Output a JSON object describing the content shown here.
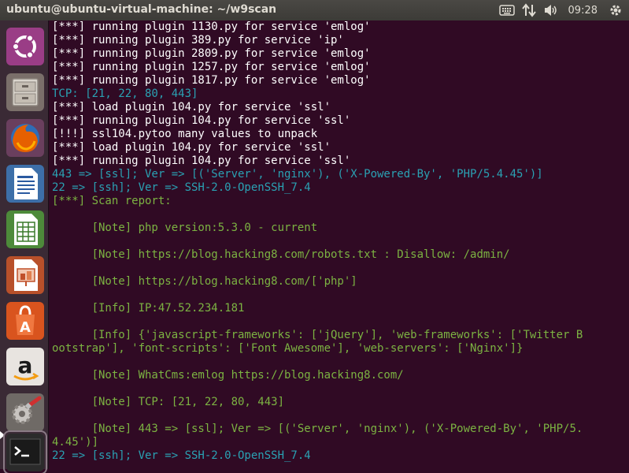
{
  "window": {
    "title": "ubuntu@ubuntu-virtual-machine: ~/w9scan"
  },
  "tray": {
    "keyboard_icon": "keyboard-icon",
    "network_icon": "network-arrows-icon",
    "volume_icon": "volume-icon",
    "time": "09:28",
    "settings_icon": "gear-icon"
  },
  "launcher": {
    "items": [
      {
        "name": "Ubuntu Dash",
        "icon": "ubuntu-logo-icon"
      },
      {
        "name": "Files",
        "icon": "file-cabinet-icon"
      },
      {
        "name": "Firefox",
        "icon": "firefox-icon"
      },
      {
        "name": "LibreOffice Writer",
        "icon": "writer-icon"
      },
      {
        "name": "LibreOffice Calc",
        "icon": "calc-icon"
      },
      {
        "name": "LibreOffice Impress",
        "icon": "impress-icon"
      },
      {
        "name": "Ubuntu Software",
        "icon": "software-center-icon"
      },
      {
        "name": "Amazon",
        "icon": "amazon-icon"
      },
      {
        "name": "System Settings",
        "icon": "settings-tools-icon"
      },
      {
        "name": "Terminal",
        "icon": "terminal-icon"
      }
    ]
  },
  "terminal": {
    "lines": [
      "[***] running plugin 1130.py for service 'emlog'",
      "[***] running plugin 389.py for service 'ip'",
      "[***] running plugin 2809.py for service 'emlog'",
      "[***] running plugin 1257.py for service 'emlog'",
      "[***] running plugin 1817.py for service 'emlog'",
      "TCP: [21, 22, 80, 443]",
      "[***] load plugin 104.py for service 'ssl'",
      "[***] running plugin 104.py for service 'ssl'",
      "[!!!] ssl104.pytoo many values to unpack",
      "[***] load plugin 104.py for service 'ssl'",
      "[***] running plugin 104.py for service 'ssl'",
      "443 => [ssl]; Ver => [('Server', 'nginx'), ('X-Powered-By', 'PHP/5.4.45')]",
      "22 => [ssh]; Ver => SSH-2.0-OpenSSH_7.4",
      "[***] Scan report:",
      "",
      "      [Note] php version:5.3.0 - current",
      "",
      "      [Note] https://blog.hacking8.com/robots.txt : Disallow: /admin/",
      "",
      "      [Note] https://blog.hacking8.com/['php']",
      "",
      "      [Info] IP:47.52.234.181",
      "",
      "      [Info] {'javascript-frameworks': ['jQuery'], 'web-frameworks': ['Twitter B",
      "ootstrap'], 'font-scripts': ['Font Awesome'], 'web-servers': ['Nginx']}",
      "",
      "      [Note] WhatCms:emlog https://blog.hacking8.com/",
      "",
      "      [Note] TCP: [21, 22, 80, 443]",
      "",
      "      [Note] 443 => [ssl]; Ver => [('Server', 'nginx'), ('X-Powered-By', 'PHP/5.",
      "4.45')]",
      "22 => [ssh]; Ver => SSH-2.0-OpenSSH_7.4"
    ],
    "colors": {
      "default": "#ffffff",
      "cyan": "#2aa1b3",
      "green": "#7cb342",
      "background": "#300a24"
    }
  }
}
